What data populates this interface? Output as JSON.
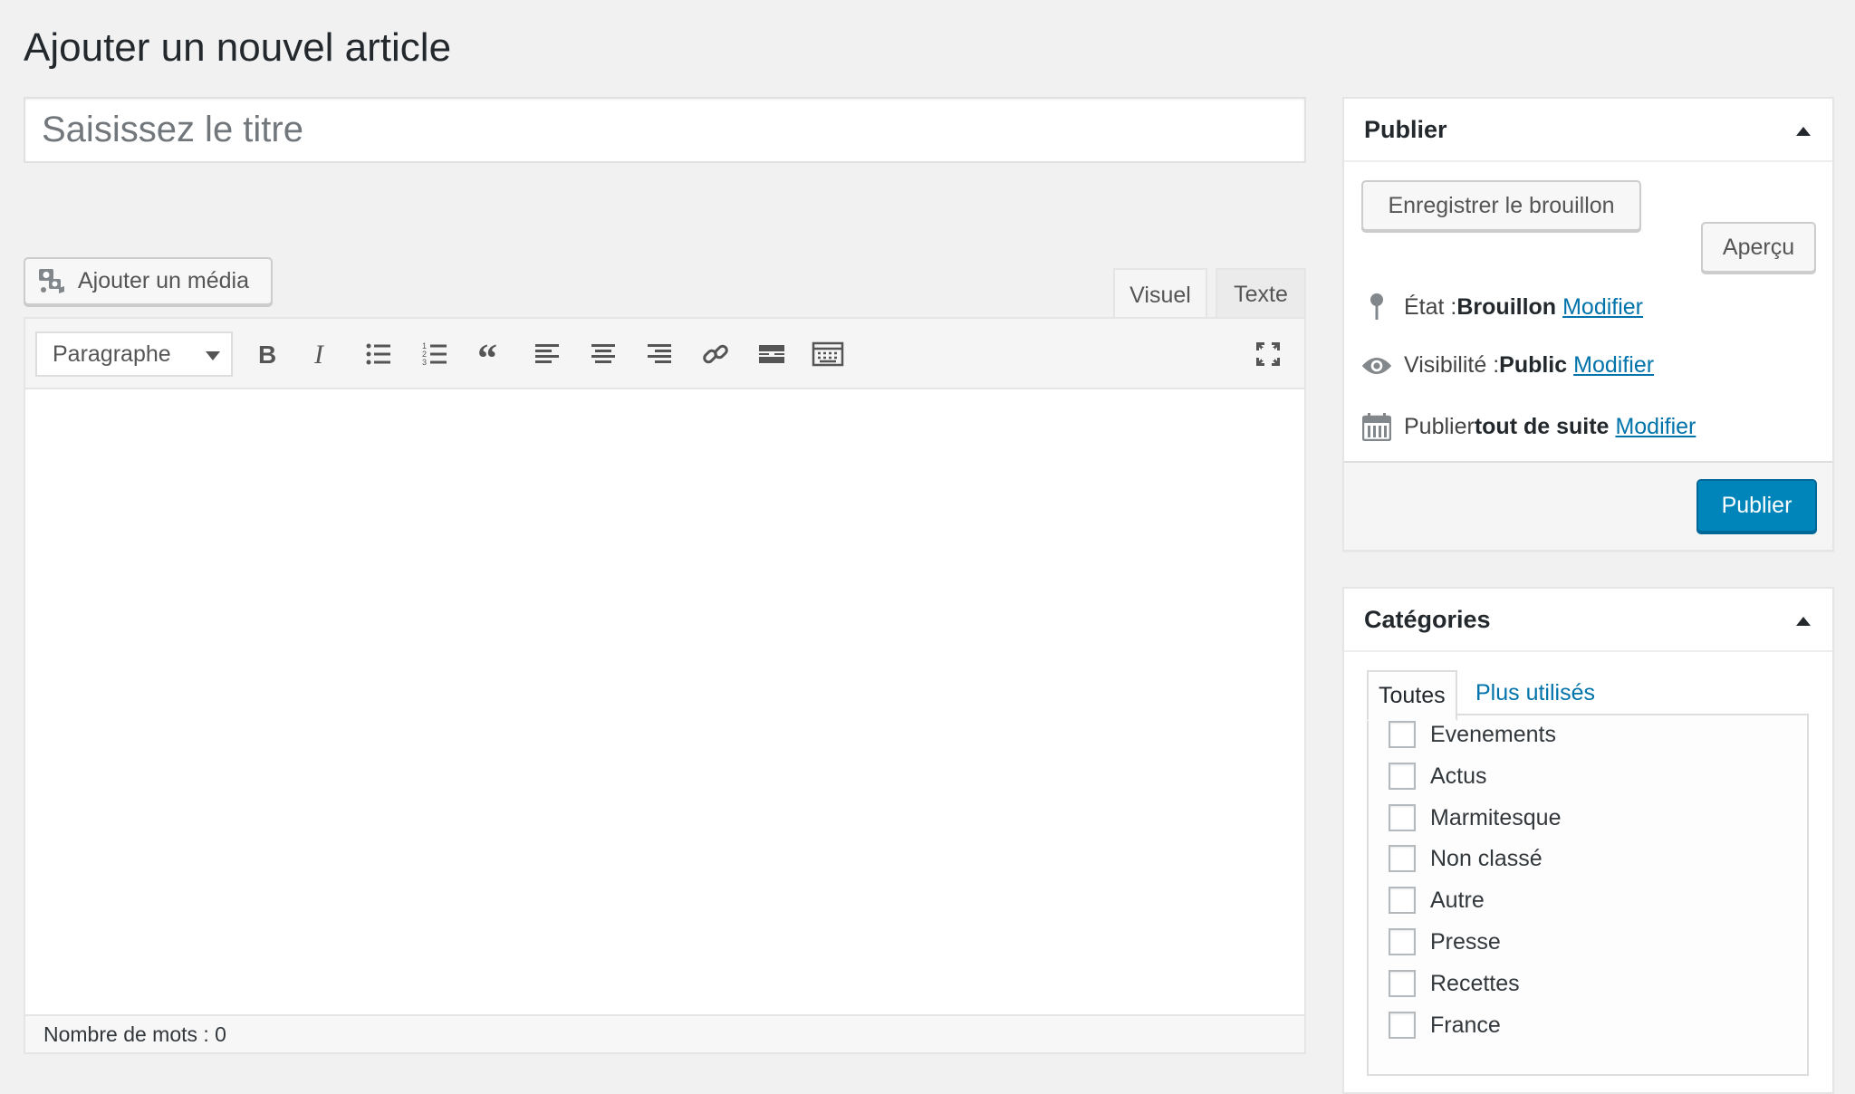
{
  "page": {
    "title": "Ajouter un nouvel article"
  },
  "title_field": {
    "value": "",
    "placeholder": "Saisissez le titre"
  },
  "media": {
    "add_media_label": "Ajouter un média"
  },
  "editor": {
    "tabs": [
      {
        "label": "Visuel",
        "active": true
      },
      {
        "label": "Texte",
        "active": false
      }
    ],
    "format_select": {
      "value": "Paragraphe"
    },
    "toolbar_icons": [
      "bold-icon",
      "italic-icon",
      "bulleted-list-icon",
      "numbered-list-icon",
      "blockquote-icon",
      "align-left-icon",
      "align-center-icon",
      "align-right-icon",
      "link-icon",
      "read-more-icon",
      "toolbar-toggle-icon",
      "fullscreen-icon"
    ],
    "word_count": "Nombre de mots : 0"
  },
  "publish": {
    "title": "Publier",
    "save_draft_label": "Enregistrer le brouillon",
    "preview_label": "Aperçu",
    "status": {
      "prefix": "État : ",
      "value": "Brouillon",
      "link": "Modifier"
    },
    "visibility": {
      "prefix": "Visibilité : ",
      "value": "Public",
      "link": "Modifier"
    },
    "schedule": {
      "prefix": "Publier ",
      "value": "tout de suite",
      "link": "Modifier"
    },
    "publish_label": "Publier"
  },
  "categories": {
    "title": "Catégories",
    "tabs": [
      {
        "label": "Toutes",
        "active": true
      },
      {
        "label": "Plus utilisés",
        "active": false
      }
    ],
    "items": [
      {
        "label": "Evenements",
        "checked": false
      },
      {
        "label": "Actus",
        "checked": false
      },
      {
        "label": "Marmitesque",
        "checked": false
      },
      {
        "label": "Non classé",
        "checked": false
      },
      {
        "label": "Autre",
        "checked": false
      },
      {
        "label": "Presse",
        "checked": false
      },
      {
        "label": "Recettes",
        "checked": false
      },
      {
        "label": "France",
        "checked": false
      }
    ]
  },
  "colors": {
    "primary": "#0085ba",
    "link": "#0073aa",
    "background": "#f1f1f1"
  }
}
